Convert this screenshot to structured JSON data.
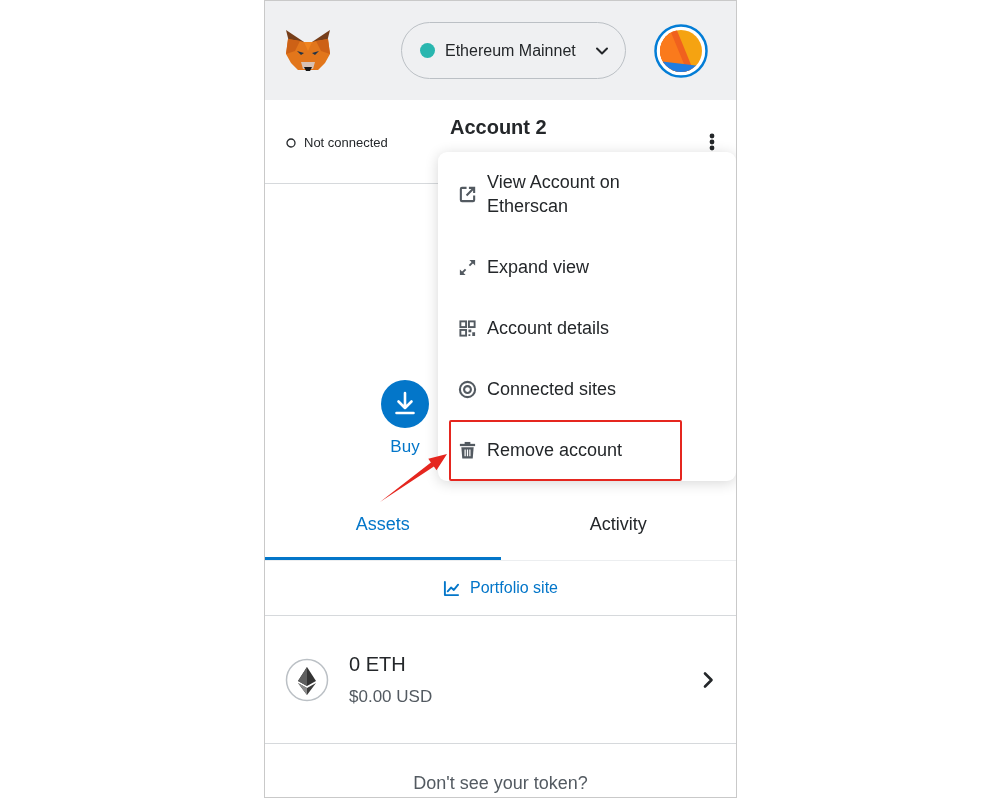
{
  "header": {
    "network": "Ethereum Mainnet"
  },
  "account_bar": {
    "connection_status": "Not connected",
    "account_name": "Account 2"
  },
  "actions": [
    {
      "label": "Buy"
    }
  ],
  "account_menu": {
    "items": [
      {
        "label": "View Account on Etherscan",
        "highlighted": false
      },
      {
        "label": "Expand view",
        "highlighted": false
      },
      {
        "label": "Account details",
        "highlighted": false
      },
      {
        "label": "Connected sites",
        "highlighted": false
      },
      {
        "label": "Remove account",
        "highlighted": true
      }
    ]
  },
  "tabs": [
    {
      "label": "Assets",
      "selected": true
    },
    {
      "label": "Activity",
      "selected": false
    }
  ],
  "portfolio_link": {
    "label": "Portfolio site"
  },
  "assets": [
    {
      "amount": "0 ETH",
      "fiat_value": "$0.00 USD"
    }
  ],
  "footer": {
    "prompt": "Don't see your token?"
  }
}
